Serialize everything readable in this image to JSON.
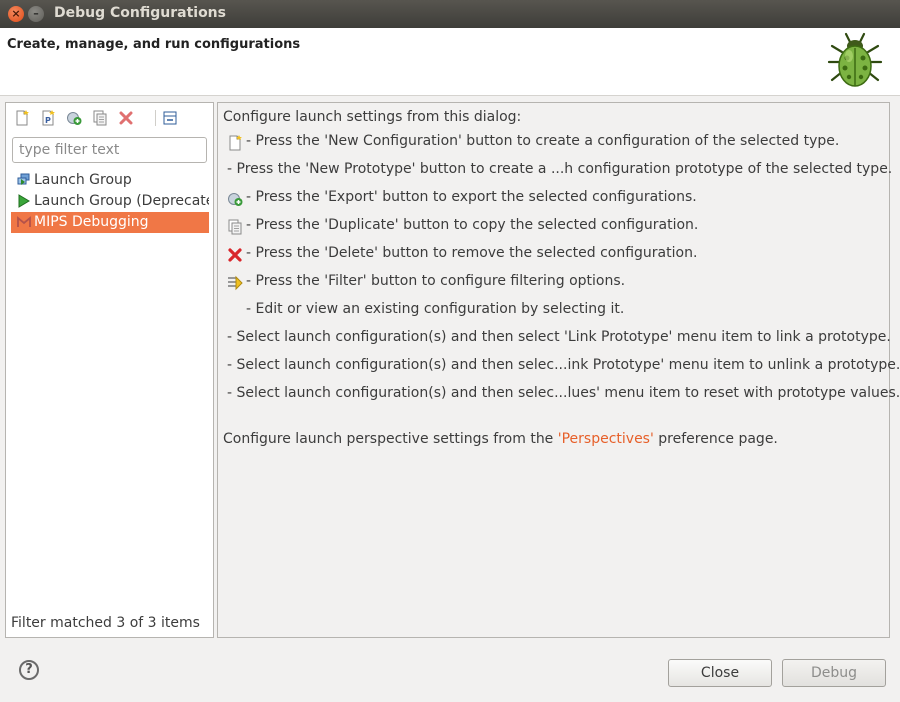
{
  "window": {
    "title": "Debug Configurations"
  },
  "banner": {
    "text": "Create, manage, and run configurations"
  },
  "filter": {
    "placeholder": "type filter text",
    "value": ""
  },
  "tree": {
    "items": [
      {
        "label": "Launch Group",
        "icon": "launch-group-icon",
        "selected": false
      },
      {
        "label": "Launch Group (Deprecated)",
        "icon": "play-icon",
        "selected": false
      },
      {
        "label": "MIPS Debugging",
        "icon": "mips-icon",
        "selected": true
      }
    ]
  },
  "status": {
    "text": "Filter matched 3 of 3 items"
  },
  "help": {
    "intro": "Configure launch settings from this dialog:",
    "lines": [
      {
        "icon": "new-configuration-icon",
        "text": "- Press the 'New Configuration' button to create a configuration of the selected type."
      },
      {
        "icon": "",
        "text": "- Press the 'New Prototype' button to create a ...h configuration prototype of the selected type."
      },
      {
        "icon": "export-icon",
        "text": "- Press the 'Export' button to export the selected configurations."
      },
      {
        "icon": "duplicate-icon",
        "text": "- Press the 'Duplicate' button to copy the selected configuration."
      },
      {
        "icon": "delete-icon",
        "text": "- Press the 'Delete' button to remove the selected configuration."
      },
      {
        "icon": "filter-icon",
        "text": "- Press the 'Filter' button to configure filtering options."
      },
      {
        "icon": "",
        "text": "- Edit or view an existing configuration by selecting it."
      },
      {
        "icon": "",
        "text": "- Select launch configuration(s) and then select 'Link Prototype' menu item to link a prototype."
      },
      {
        "icon": "",
        "text": "- Select launch configuration(s) and then selec...ink Prototype' menu item to unlink a prototype."
      },
      {
        "icon": "",
        "text": "- Select launch configuration(s) and then selec...lues' menu item to reset with prototype values."
      }
    ],
    "perspective_prefix": "Configure launch perspective settings from the ",
    "perspective_link": "'Perspectives'",
    "perspective_suffix": " preference page."
  },
  "buttons": {
    "close": "Close",
    "debug": "Debug",
    "help": "?"
  },
  "colors": {
    "selection": "#f07746",
    "link": "#e7602a",
    "delete": "#d9262b"
  }
}
